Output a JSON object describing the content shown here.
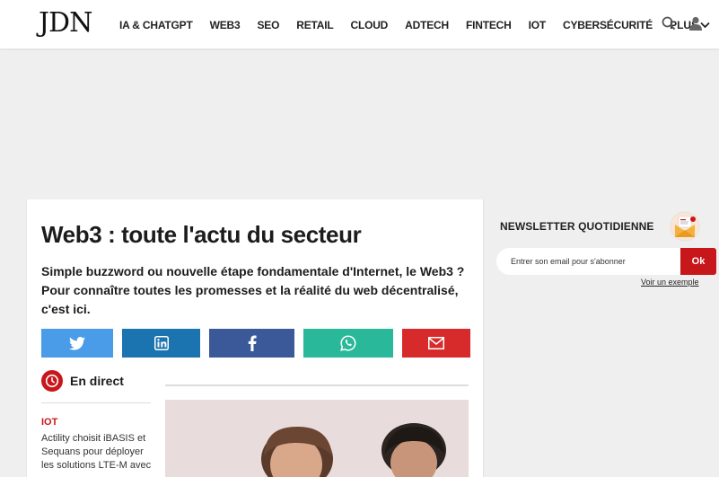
{
  "header": {
    "logo": "JDN",
    "nav": [
      "IA & CHATGPT",
      "WEB3",
      "SEO",
      "RETAIL",
      "CLOUD",
      "ADTECH",
      "FINTECH",
      "IOT",
      "CYBERSÉCURITÉ"
    ],
    "more_label": "PLUS",
    "icons": [
      "search-icon",
      "user-icon",
      "chevron-down-icon"
    ]
  },
  "main": {
    "title": "Web3 : toute l'actu du secteur",
    "intro": "Simple buzzword ou nouvelle étape fondamentale d'Internet, le Web3 ? Pour connaître toutes les promesses et la réalité du web décentralisé, c'est ici.",
    "share_buttons": [
      {
        "icon": "twitter-icon",
        "color": "#4a9be8"
      },
      {
        "icon": "linkedin-icon",
        "color": "#1b73b0"
      },
      {
        "icon": "facebook-icon",
        "color": "#3b5998"
      },
      {
        "icon": "whatsapp-icon",
        "color": "#29b89a"
      },
      {
        "icon": "email-icon",
        "color": "#d72b2b"
      }
    ],
    "live": {
      "label": "En direct",
      "category": "IOT",
      "headline": "Actility choisit iBASIS et Sequans pour déployer les solutions LTE-M avec"
    }
  },
  "sidebar": {
    "newsletter_title": "NEWSLETTER QUOTIDIENNE",
    "email_placeholder": "Entrer son email pour s'abonner",
    "submit_label": "Ok",
    "example_link": "Voir un exemple"
  },
  "colors": {
    "accent_red": "#c8171b",
    "background": "#efefef"
  }
}
